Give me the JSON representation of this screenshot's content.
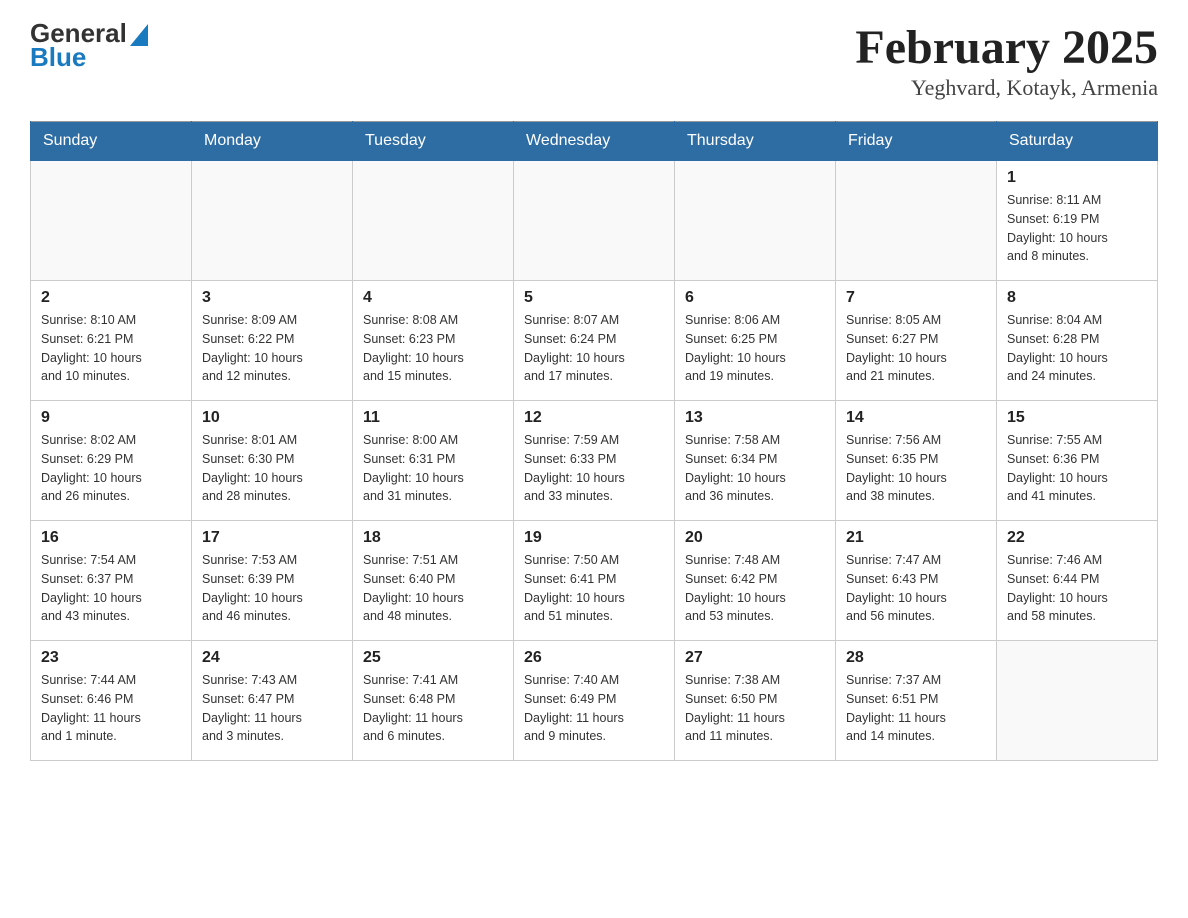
{
  "header": {
    "month_title": "February 2025",
    "location": "Yeghvard, Kotayk, Armenia",
    "logo_general": "General",
    "logo_blue": "Blue"
  },
  "weekdays": [
    "Sunday",
    "Monday",
    "Tuesday",
    "Wednesday",
    "Thursday",
    "Friday",
    "Saturday"
  ],
  "weeks": [
    [
      {
        "day": "",
        "info": ""
      },
      {
        "day": "",
        "info": ""
      },
      {
        "day": "",
        "info": ""
      },
      {
        "day": "",
        "info": ""
      },
      {
        "day": "",
        "info": ""
      },
      {
        "day": "",
        "info": ""
      },
      {
        "day": "1",
        "info": "Sunrise: 8:11 AM\nSunset: 6:19 PM\nDaylight: 10 hours\nand 8 minutes."
      }
    ],
    [
      {
        "day": "2",
        "info": "Sunrise: 8:10 AM\nSunset: 6:21 PM\nDaylight: 10 hours\nand 10 minutes."
      },
      {
        "day": "3",
        "info": "Sunrise: 8:09 AM\nSunset: 6:22 PM\nDaylight: 10 hours\nand 12 minutes."
      },
      {
        "day": "4",
        "info": "Sunrise: 8:08 AM\nSunset: 6:23 PM\nDaylight: 10 hours\nand 15 minutes."
      },
      {
        "day": "5",
        "info": "Sunrise: 8:07 AM\nSunset: 6:24 PM\nDaylight: 10 hours\nand 17 minutes."
      },
      {
        "day": "6",
        "info": "Sunrise: 8:06 AM\nSunset: 6:25 PM\nDaylight: 10 hours\nand 19 minutes."
      },
      {
        "day": "7",
        "info": "Sunrise: 8:05 AM\nSunset: 6:27 PM\nDaylight: 10 hours\nand 21 minutes."
      },
      {
        "day": "8",
        "info": "Sunrise: 8:04 AM\nSunset: 6:28 PM\nDaylight: 10 hours\nand 24 minutes."
      }
    ],
    [
      {
        "day": "9",
        "info": "Sunrise: 8:02 AM\nSunset: 6:29 PM\nDaylight: 10 hours\nand 26 minutes."
      },
      {
        "day": "10",
        "info": "Sunrise: 8:01 AM\nSunset: 6:30 PM\nDaylight: 10 hours\nand 28 minutes."
      },
      {
        "day": "11",
        "info": "Sunrise: 8:00 AM\nSunset: 6:31 PM\nDaylight: 10 hours\nand 31 minutes."
      },
      {
        "day": "12",
        "info": "Sunrise: 7:59 AM\nSunset: 6:33 PM\nDaylight: 10 hours\nand 33 minutes."
      },
      {
        "day": "13",
        "info": "Sunrise: 7:58 AM\nSunset: 6:34 PM\nDaylight: 10 hours\nand 36 minutes."
      },
      {
        "day": "14",
        "info": "Sunrise: 7:56 AM\nSunset: 6:35 PM\nDaylight: 10 hours\nand 38 minutes."
      },
      {
        "day": "15",
        "info": "Sunrise: 7:55 AM\nSunset: 6:36 PM\nDaylight: 10 hours\nand 41 minutes."
      }
    ],
    [
      {
        "day": "16",
        "info": "Sunrise: 7:54 AM\nSunset: 6:37 PM\nDaylight: 10 hours\nand 43 minutes."
      },
      {
        "day": "17",
        "info": "Sunrise: 7:53 AM\nSunset: 6:39 PM\nDaylight: 10 hours\nand 46 minutes."
      },
      {
        "day": "18",
        "info": "Sunrise: 7:51 AM\nSunset: 6:40 PM\nDaylight: 10 hours\nand 48 minutes."
      },
      {
        "day": "19",
        "info": "Sunrise: 7:50 AM\nSunset: 6:41 PM\nDaylight: 10 hours\nand 51 minutes."
      },
      {
        "day": "20",
        "info": "Sunrise: 7:48 AM\nSunset: 6:42 PM\nDaylight: 10 hours\nand 53 minutes."
      },
      {
        "day": "21",
        "info": "Sunrise: 7:47 AM\nSunset: 6:43 PM\nDaylight: 10 hours\nand 56 minutes."
      },
      {
        "day": "22",
        "info": "Sunrise: 7:46 AM\nSunset: 6:44 PM\nDaylight: 10 hours\nand 58 minutes."
      }
    ],
    [
      {
        "day": "23",
        "info": "Sunrise: 7:44 AM\nSunset: 6:46 PM\nDaylight: 11 hours\nand 1 minute."
      },
      {
        "day": "24",
        "info": "Sunrise: 7:43 AM\nSunset: 6:47 PM\nDaylight: 11 hours\nand 3 minutes."
      },
      {
        "day": "25",
        "info": "Sunrise: 7:41 AM\nSunset: 6:48 PM\nDaylight: 11 hours\nand 6 minutes."
      },
      {
        "day": "26",
        "info": "Sunrise: 7:40 AM\nSunset: 6:49 PM\nDaylight: 11 hours\nand 9 minutes."
      },
      {
        "day": "27",
        "info": "Sunrise: 7:38 AM\nSunset: 6:50 PM\nDaylight: 11 hours\nand 11 minutes."
      },
      {
        "day": "28",
        "info": "Sunrise: 7:37 AM\nSunset: 6:51 PM\nDaylight: 11 hours\nand 14 minutes."
      },
      {
        "day": "",
        "info": ""
      }
    ]
  ]
}
